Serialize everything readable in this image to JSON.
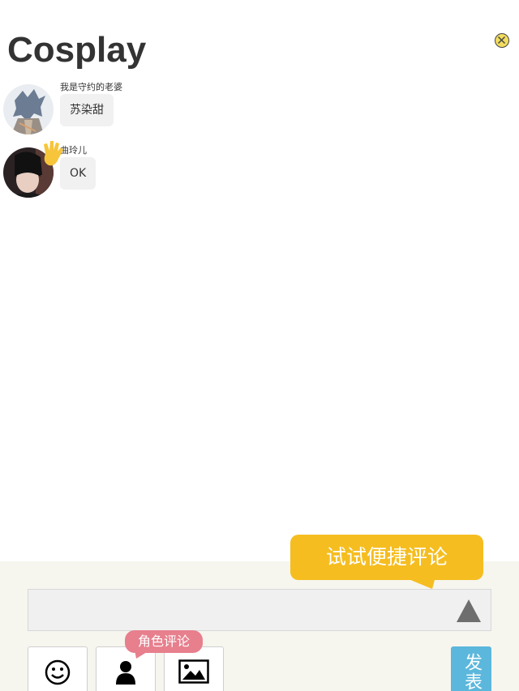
{
  "page": {
    "title": "Cosplay"
  },
  "messages": [
    {
      "username": "我是守约的老婆",
      "text": "苏染甜"
    },
    {
      "username": "曲玲儿",
      "text": "OK"
    }
  ],
  "composer": {
    "input_value": "",
    "quick_comment_tip": "试试便捷评论",
    "role_comment_tip": "角色评论",
    "send_label": "发表"
  },
  "icons": {
    "close": "close-circle-icon",
    "expand": "triangle-up-icon",
    "emoji": "smiley-icon",
    "role": "person-icon",
    "image": "image-icon"
  },
  "colors": {
    "quick_tip_bg": "#f5bd1f",
    "role_tip_bg": "#e77f8d",
    "send_bg": "#5bb7dc",
    "bottom_bg": "#f6f5ee"
  }
}
